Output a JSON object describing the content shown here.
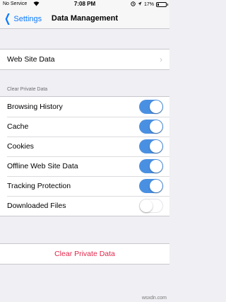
{
  "status_bar": {
    "carrier": "No Service",
    "time": "7:08 PM",
    "battery_percent": "17%",
    "battery_level": 0.17
  },
  "nav": {
    "back_label": "Settings",
    "title": "Data Management"
  },
  "website_group": {
    "label": "Web Site Data"
  },
  "section_header": "Clear Private Data",
  "toggles": [
    {
      "label": "Browsing History",
      "on": true
    },
    {
      "label": "Cache",
      "on": true
    },
    {
      "label": "Cookies",
      "on": true
    },
    {
      "label": "Offline Web Site Data",
      "on": true
    },
    {
      "label": "Tracking Protection",
      "on": true
    },
    {
      "label": "Downloaded Files",
      "on": false
    }
  ],
  "clear_button": "Clear Private Data",
  "watermark": "wsxdn.com",
  "colors": {
    "accent": "#0a7aff",
    "toggle_on": "#4a90e2",
    "destructive": "#e0264a",
    "background": "#efeff4"
  }
}
